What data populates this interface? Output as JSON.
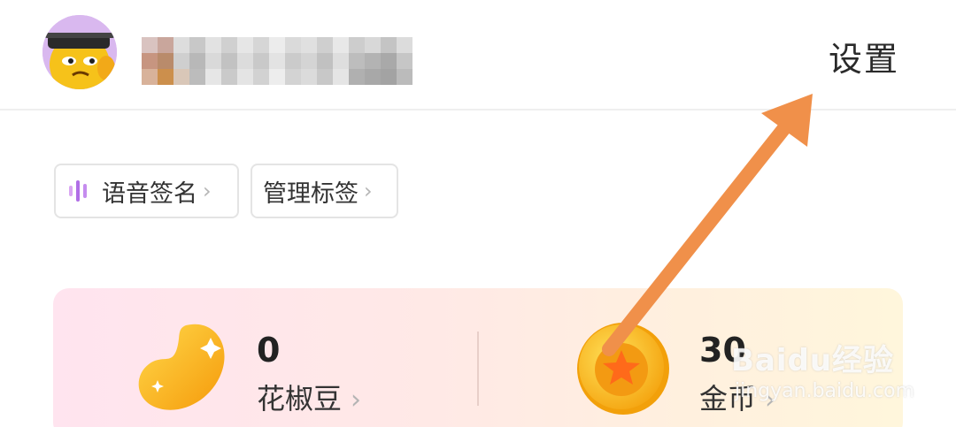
{
  "header": {
    "settings_label": "设置"
  },
  "chips": {
    "voice_signature": "语音签名",
    "manage_tags": "管理标签",
    "chevron": "›"
  },
  "wallet": {
    "beans": {
      "value": "0",
      "label": "花椒豆"
    },
    "coins": {
      "value": "30",
      "label": "金币"
    },
    "chevron": "›"
  },
  "icons": [
    "avatar-icon",
    "voice-wave-icon",
    "bean-icon",
    "coin-icon",
    "arrow-annotation"
  ],
  "watermark": {
    "main": "Baidu经验",
    "sub": "jingyan.baidu.com"
  },
  "colors": {
    "accent_purple": "#b06ee6",
    "arrow_orange": "#f0904a",
    "coin_gold": "#ffc21a"
  }
}
